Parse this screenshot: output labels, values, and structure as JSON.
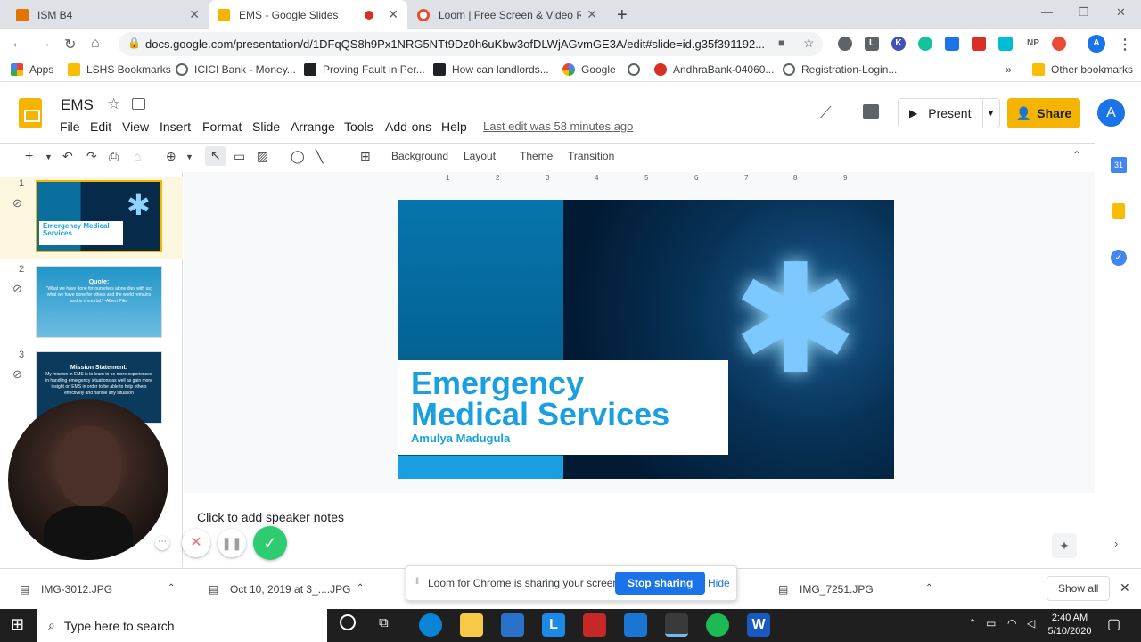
{
  "tabs": [
    {
      "title": "ISM B4",
      "color": "#e37400"
    },
    {
      "title": "EMS - Google Slides",
      "color": "#f4b400"
    },
    {
      "title": "Loom | Free Screen & Video Reco",
      "color": "#e94b35"
    }
  ],
  "address": {
    "url": "docs.google.com/presentation/d/1DFqQS8h9Px1NRG5NTt9Dz0h6uKbw3ofDLWjAGvmGE3A/edit#slide=id.g35f391192..."
  },
  "extensions": [
    "L",
    "K",
    "NP"
  ],
  "bookmarks": [
    "Apps",
    "LSHS Bookmarks",
    "ICICI Bank - Money...",
    "Proving Fault in Per...",
    "How can landlords...",
    "Google",
    "AndhraBank-04060...",
    "Registration-Login...",
    "Other bookmarks"
  ],
  "doc": {
    "title": "EMS",
    "menus": [
      "File",
      "Edit",
      "View",
      "Insert",
      "Format",
      "Slide",
      "Arrange",
      "Tools",
      "Add-ons",
      "Help"
    ],
    "last_edit": "Last edit was 58 minutes ago",
    "present": "Present",
    "share": "Share",
    "avatar": "A"
  },
  "toolbar": {
    "background": "Background",
    "layout": "Layout",
    "theme": "Theme",
    "transition": "Transition"
  },
  "ruler": [
    "1",
    "2",
    "3",
    "4",
    "5",
    "6",
    "7",
    "8",
    "9"
  ],
  "slides": [
    {
      "num": "1",
      "title": "Emergency Medical Services",
      "author": "Amulya Madugula"
    },
    {
      "num": "2",
      "heading": "Quote:",
      "text": "\"What we have done for ourselves alone dies with us; what we have done for others and the world remains and is immortal.\" -Albert Pike"
    },
    {
      "num": "3",
      "heading": "Mission Statement:",
      "text": "My mission in EMS is to learn to be more experienced in handling emergency situations as well as gain more insight on EMS in order to be able to help others effectively and handle any situation"
    }
  ],
  "main_slide": {
    "line1": "Emergency",
    "line2": "Medical Services",
    "author": "Amulya Madugula"
  },
  "notes": "Click to add speaker notes",
  "downloads": [
    "IMG-3012.JPG",
    "Oct 10, 2019 at 3_....JPG",
    "IMG_7251.JPG"
  ],
  "downloads_show_all": "Show all",
  "loom": {
    "message": "Loom for Chrome is sharing your screen.",
    "stop": "Stop sharing",
    "hide": "Hide"
  },
  "taskbar": {
    "search_placeholder": "Type here to search",
    "time": "2:40 AM",
    "date": "5/10/2020"
  }
}
